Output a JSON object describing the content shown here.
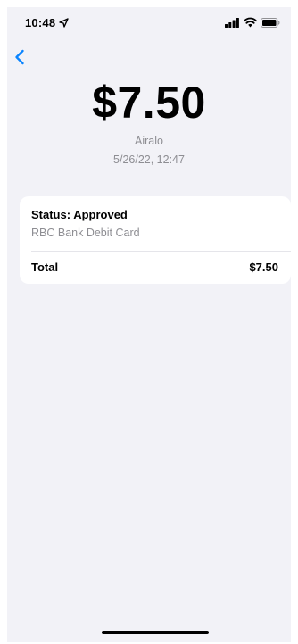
{
  "status_bar": {
    "time": "10:48",
    "icons": [
      "location-arrow-icon",
      "cellular-signal-icon",
      "wifi-icon",
      "battery-icon"
    ]
  },
  "navigation": {
    "back_icon": "chevron-left-icon"
  },
  "transaction": {
    "amount": "$7.50",
    "merchant": "Airalo",
    "datetime": "5/26/22, 12:47"
  },
  "details_card": {
    "status": "Status: Approved",
    "payment_method": "RBC Bank Debit Card",
    "total_label": "Total",
    "total_value": "$7.50"
  },
  "colors": {
    "background": "#f2f2f7",
    "card": "#ffffff",
    "accent": "#0a84ff",
    "secondary_text": "#8e8e93",
    "primary_text": "#000000"
  }
}
